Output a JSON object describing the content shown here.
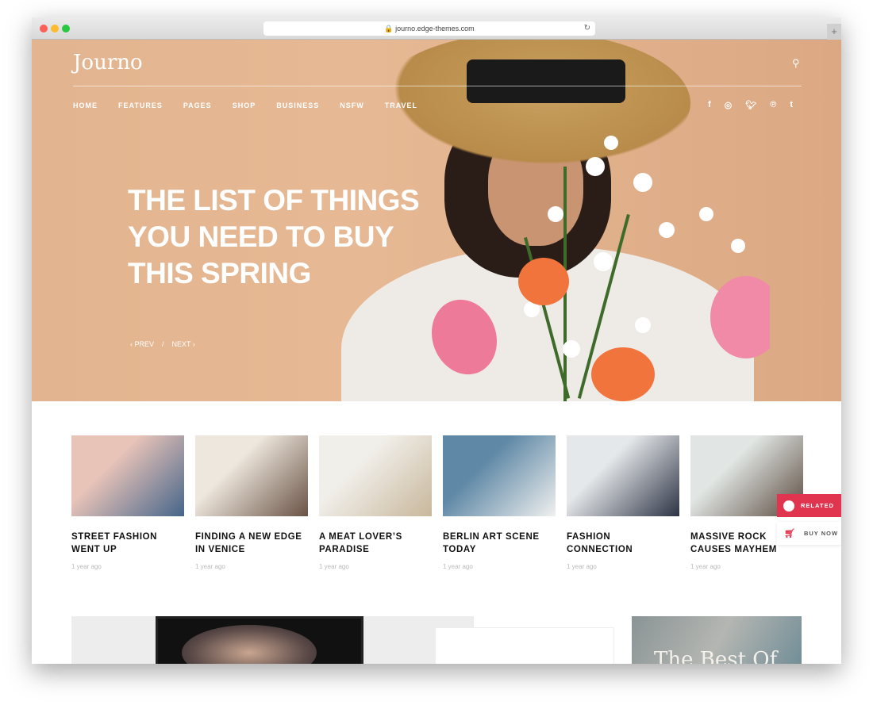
{
  "browser": {
    "url": "journo.edge-themes.com"
  },
  "header": {
    "logo": "Journo",
    "nav": [
      "HOME",
      "FEATURES",
      "PAGES",
      "SHOP",
      "BUSINESS",
      "NSFW",
      "TRAVEL"
    ],
    "social": [
      "facebook-icon",
      "instagram-icon",
      "twitter-icon",
      "pinterest-icon",
      "tumblr-icon"
    ]
  },
  "hero": {
    "title": "THE LIST OF THINGS YOU NEED TO BUY THIS SPRING",
    "prev": "PREV",
    "sep": "/",
    "next": "NEXT"
  },
  "cards": [
    {
      "title": "STREET FASHION WENT UP",
      "date": "1 year ago",
      "c1": "#e8c3b8",
      "c2": "#45658a"
    },
    {
      "title": "FINDING A NEW EDGE IN VENICE",
      "date": "1 year ago",
      "c1": "#ede7dd",
      "c2": "#6a5245"
    },
    {
      "title": "A MEAT LOVER’S PARADISE",
      "date": "1 year ago",
      "c1": "#f1efea",
      "c2": "#c8b79b"
    },
    {
      "title": "BERLIN ART SCENE TODAY",
      "date": "1 year ago",
      "c1": "#5e88a6",
      "c2": "#f0f0ef"
    },
    {
      "title": "FASHION CONNECTION",
      "date": "1 year ago",
      "c1": "#e5e8ea",
      "c2": "#2c3344"
    },
    {
      "title": "MASSIVE ROCK CAUSES MAYHEM",
      "date": "1 year ago",
      "c1": "#e1e6e4",
      "c2": "#5a4a3f"
    }
  ],
  "sidebar": {
    "related": "RELATED",
    "buy": "BUY NOW",
    "accent": "#e0344f"
  },
  "bottom": {
    "featured_text": "The Best Of"
  }
}
